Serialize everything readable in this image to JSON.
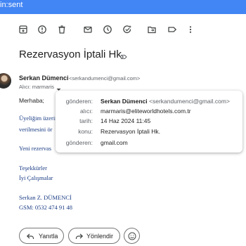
{
  "topbar": {
    "crumb": "in:sent"
  },
  "toolbar": {
    "icons": [
      "archive-icon",
      "report-spam-icon",
      "delete-icon",
      "mark-unread-icon",
      "snooze-icon",
      "add-task-icon",
      "move-to-icon",
      "label-icon",
      "more-vert-icon"
    ]
  },
  "email": {
    "subject": "Rezervasyon İptali Hk.",
    "sender_name": "Serkan Dümenci",
    "sender_email": "<serkandumenci@gmail.com>",
    "recipient": "Alıcı: marmaris",
    "body": {
      "greeting": "Merhaba;",
      "line1": "Üyeliğim üzerin",
      "line2": "verilmesini ör",
      "line3": "Yeni rezervas",
      "thanks": "Teşekkürler",
      "regards": "İyi Çalışmalar",
      "signature_name": "Serkan Z. DÜMENCİ",
      "signature_phone": "GSM: 0532 474 91 48"
    }
  },
  "details_popup": {
    "from_label": "gönderen:",
    "from_name": "Serkan Dümenci",
    "from_email": "<serkandumenci@gmail.com>",
    "to_label": "alıcı:",
    "to_value": "marmaris@eliteworldhotels.com.tr",
    "date_label": "tarih:",
    "date_value": "14 Haz 2024 11:45",
    "subject_label": "konu:",
    "subject_value": "Rezervasyon İptali Hk.",
    "mailedby_label": "gönderen:",
    "mailedby_value": "gmail.com"
  },
  "actions": {
    "reply_label": "Yanıtla",
    "forward_label": "Yönlendir"
  }
}
